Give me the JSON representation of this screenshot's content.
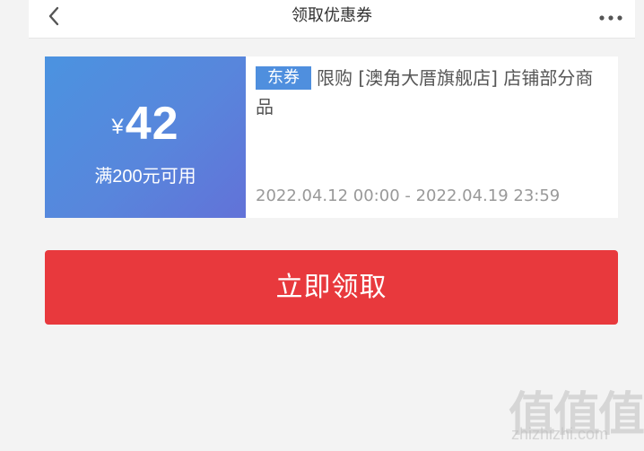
{
  "header": {
    "title": "领取优惠券",
    "back_icon": "chevron-left-icon",
    "more_icon": "more-dots-icon"
  },
  "coupon": {
    "currency_symbol": "¥",
    "amount": "42",
    "condition": "满200元可用",
    "tag": "东券",
    "description": "限购 [澳角大厝旗舰店] 店铺部分商品",
    "validity": "2022.04.12 00:00 - 2022.04.19 23:59"
  },
  "actions": {
    "claim_label": "立即领取"
  },
  "watermark": {
    "logo": "值值值",
    "url": "zhizhizhi.com"
  },
  "colors": {
    "background": "#f3f3f3",
    "coupon_gradient_start": "#4b93e0",
    "coupon_gradient_end": "#6272d8",
    "tag": "#4f8fde",
    "claim_button": "#e8393d"
  }
}
